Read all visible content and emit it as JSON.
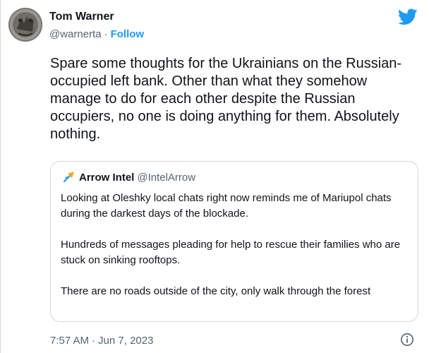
{
  "author": {
    "name": "Tom Warner",
    "handle": "@warnerta",
    "separator": "·",
    "follow_label": "Follow"
  },
  "tweet": {
    "text": "Spare some thoughts for the Ukrainians on the Russian-occupied left bank. Other than what they somehow manage to do for each other despite the Russian occupiers, no one is doing anything for them. Absolutely nothing."
  },
  "quoted_tweet": {
    "name": "Arrow Intel",
    "handle": "@IntelArrow",
    "paragraphs": [
      "Looking at Oleshky local chats right now reminds me of Mariupol chats during the darkest days of the blockade.",
      "Hundreds of messages pleading for help to rescue their families who are stuck on sinking rooftops.",
      "There are no roads outside of the city, only walk through the forest"
    ]
  },
  "footer": {
    "time": "7:57 AM",
    "separator": "·",
    "date": "Jun 7, 2023"
  },
  "icons": {
    "brand": "twitter-bird-icon",
    "info": "info-icon",
    "quote_logo": "arrow-intel-logo"
  },
  "colors": {
    "accent": "#1d9bf0",
    "text": "#0f1419",
    "secondary": "#536471",
    "border": "#cfd9de",
    "quote_logo": "#f5a623"
  }
}
